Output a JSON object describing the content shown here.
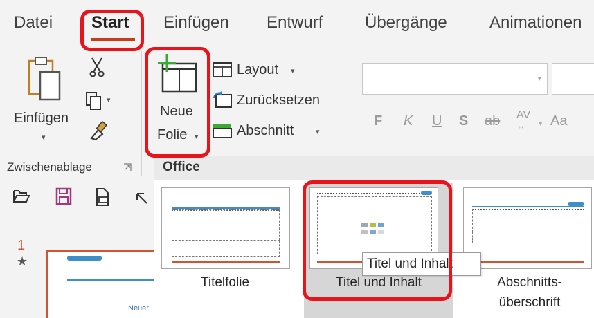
{
  "tabs": [
    {
      "label": "Datei"
    },
    {
      "label": "Start"
    },
    {
      "label": "Einfügen"
    },
    {
      "label": "Entwurf"
    },
    {
      "label": "Übergänge"
    },
    {
      "label": "Animationen"
    }
  ],
  "clipboard": {
    "paste_label": "Einfügen",
    "group_label": "Zwischenablage"
  },
  "slides": {
    "new_slide_line1": "Neue",
    "new_slide_line2": "Folie",
    "layout_label": "Layout",
    "reset_label": "Zurücksetzen",
    "section_label": "Abschnitt"
  },
  "font": {
    "bold": "F",
    "italic": "K",
    "underline": "U",
    "shadow": "S",
    "strike": "ab",
    "spacing": "AV",
    "case": "Aa"
  },
  "gallery": {
    "header": "Office",
    "layouts": [
      {
        "label": "Titelfolie"
      },
      {
        "label": "Titel und Inhalt"
      },
      {
        "label_line1": "Abschnitts-",
        "label_line2": "überschrift"
      }
    ],
    "tooltip": "Titel und Inhalt"
  },
  "pane": {
    "slide_number": "1",
    "thumb_text": "Neuer"
  },
  "colors": {
    "accent_orange": "#d35230",
    "highlight_red": "#e8141b",
    "slide_blue": "#3e8fc9",
    "new_slide_green": "#3aaa35"
  }
}
